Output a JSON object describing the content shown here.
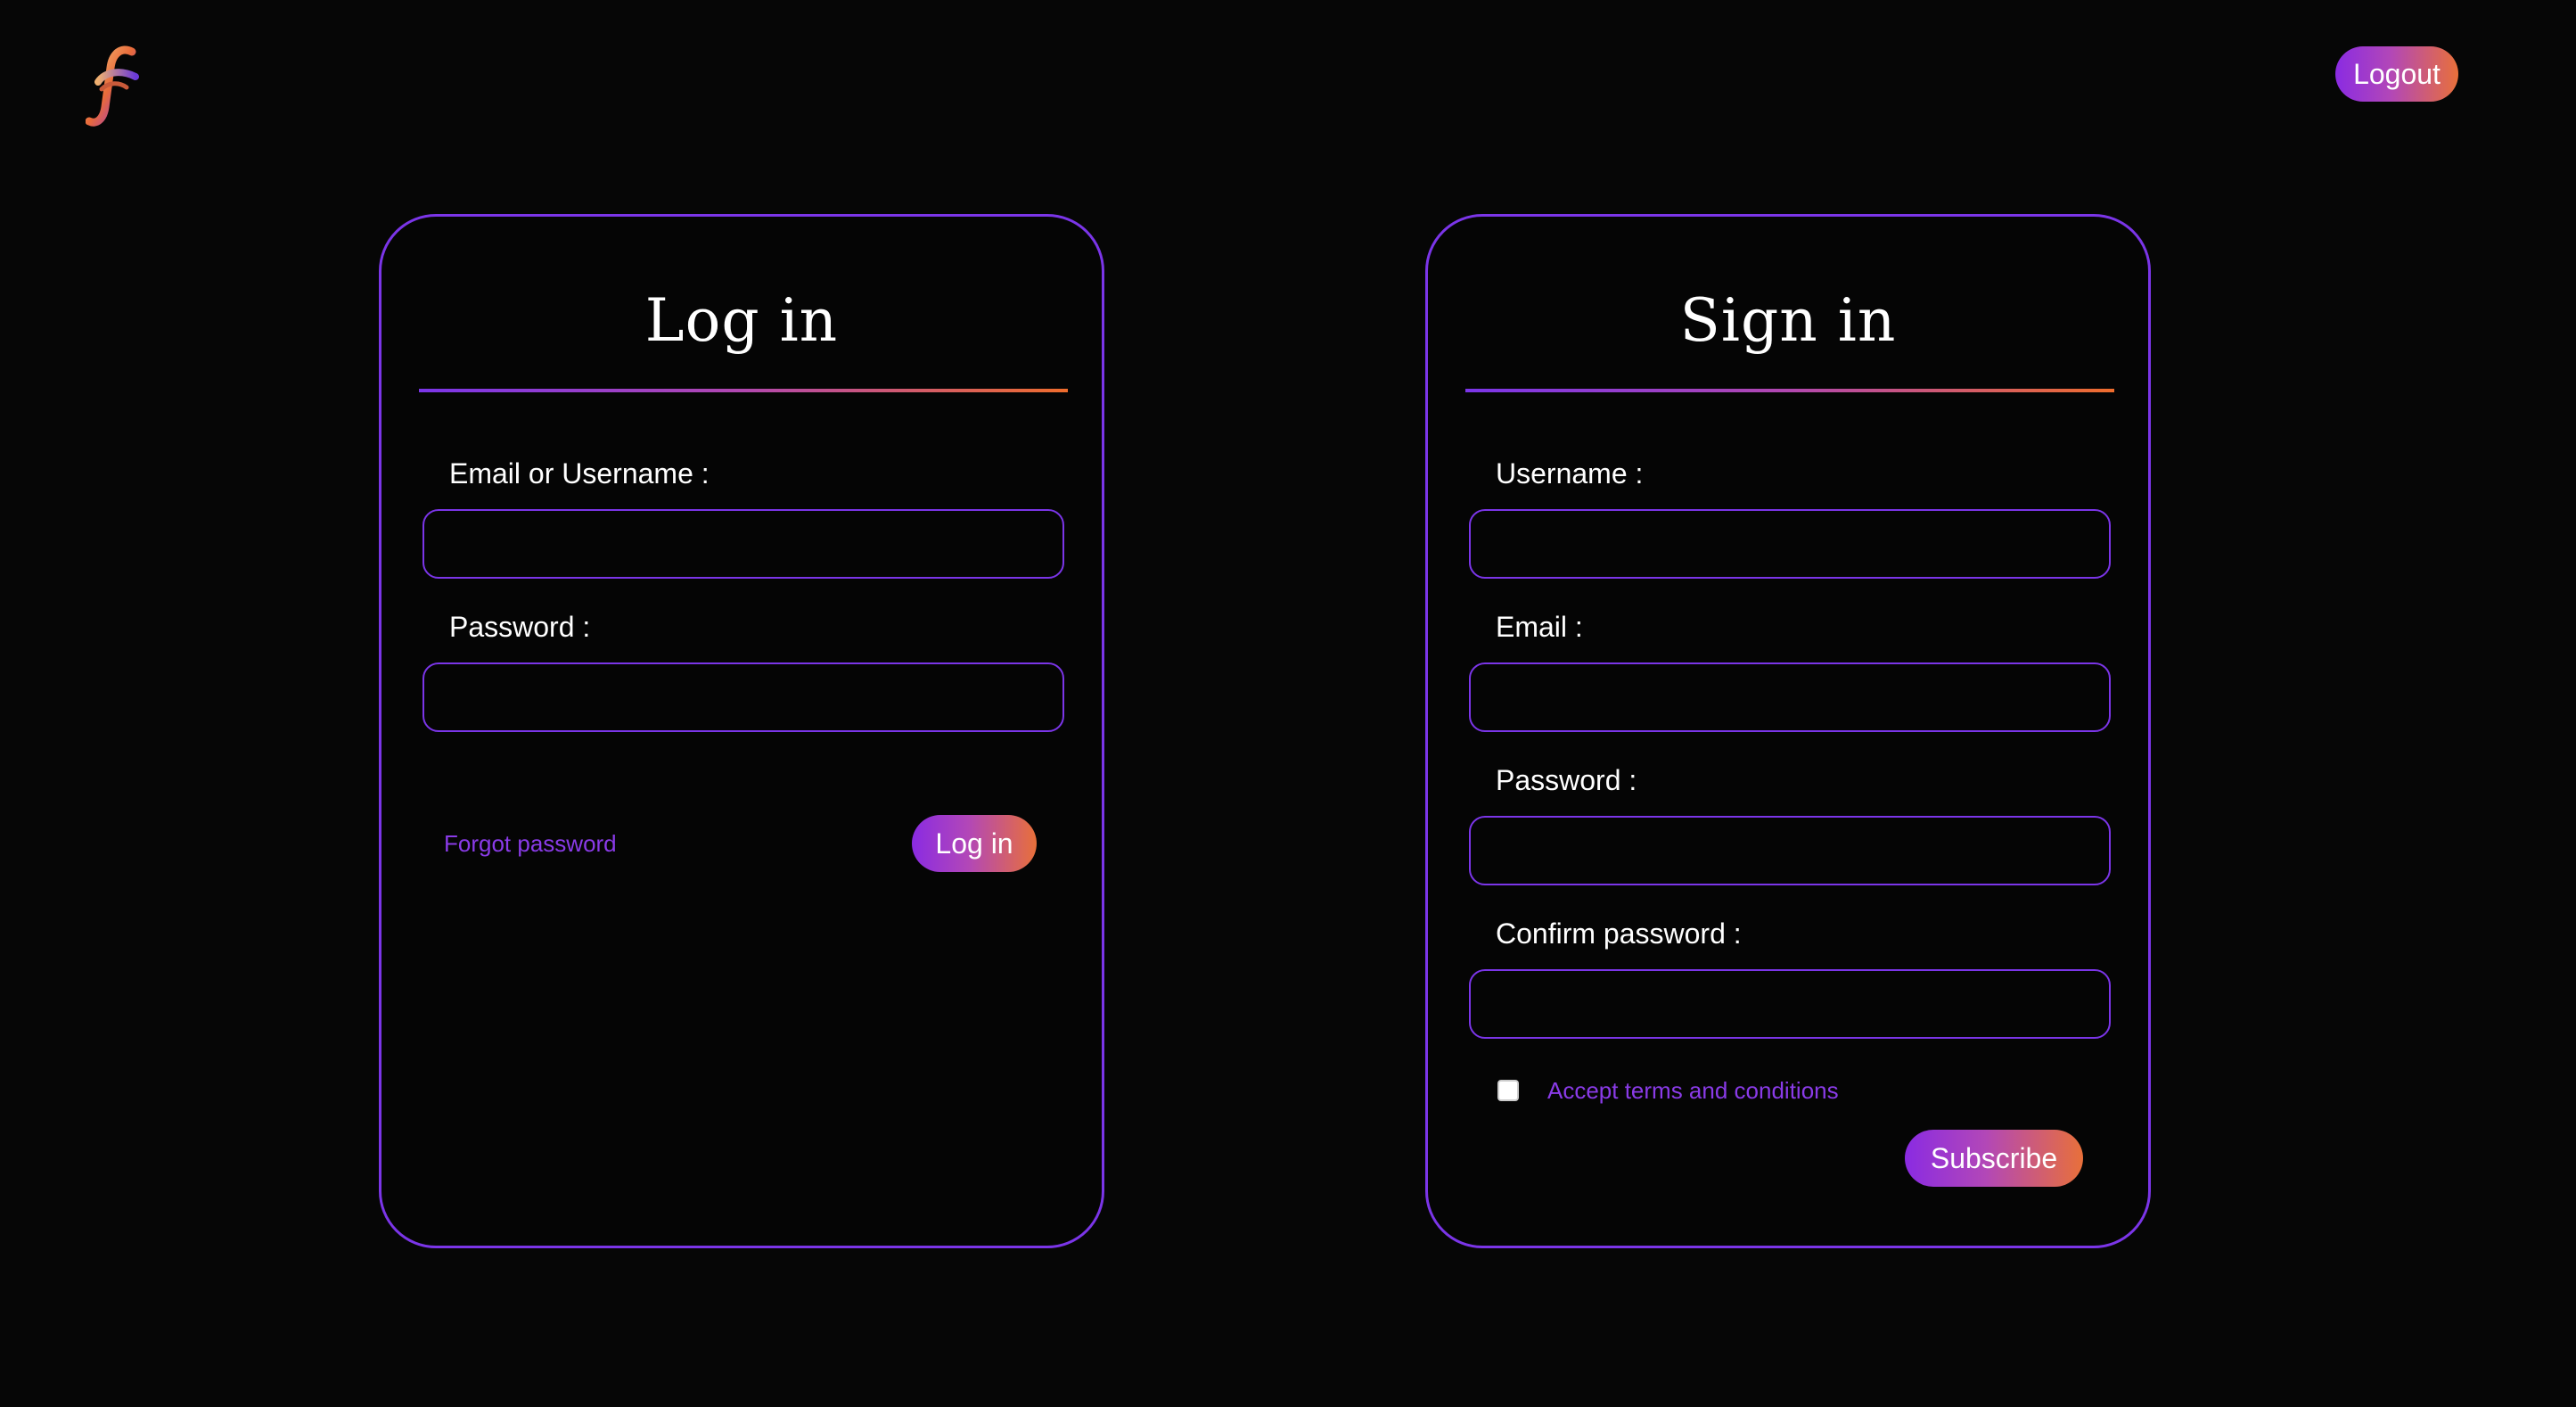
{
  "header": {
    "logo": "stylized-f-logo",
    "logout_label": "Logout"
  },
  "colors": {
    "background": "#060606",
    "accent_purple": "#7b35e8",
    "accent_orange": "#ef6d2d",
    "link": "#8a3be8"
  },
  "login": {
    "title": "Log in",
    "email_label": "Email or Username :",
    "email_value": "",
    "password_label": "Password :",
    "password_value": "",
    "forgot_label": "Forgot password",
    "submit_label": "Log in"
  },
  "signin": {
    "title": "Sign in",
    "username_label": "Username :",
    "username_value": "",
    "email_label": "Email :",
    "email_value": "",
    "password_label": "Password :",
    "password_value": "",
    "confirm_label": "Confirm password :",
    "confirm_value": "",
    "terms_checked": false,
    "terms_label": "Accept terms and conditions",
    "submit_label": "Subscribe"
  }
}
